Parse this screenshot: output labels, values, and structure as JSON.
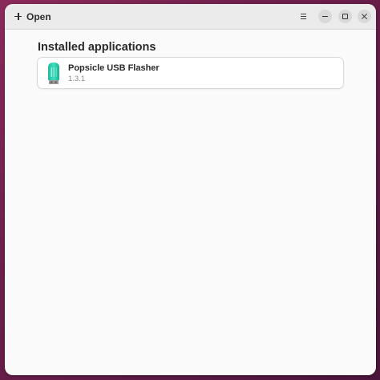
{
  "header": {
    "open_label": "Open",
    "icons": {
      "add": "plus-icon",
      "menu": "hamburger-menu-icon",
      "minimize": "minimize-icon",
      "maximize": "maximize-icon",
      "close": "close-icon"
    }
  },
  "main": {
    "section_title": "Installed applications",
    "apps": [
      {
        "name": "Popsicle USB Flasher",
        "version": "1.3.1",
        "icon": "usb-popsicle-icon"
      }
    ]
  },
  "colors": {
    "desktop_background": "#6e1f4b",
    "icon_accent": "#2fd0b0"
  }
}
